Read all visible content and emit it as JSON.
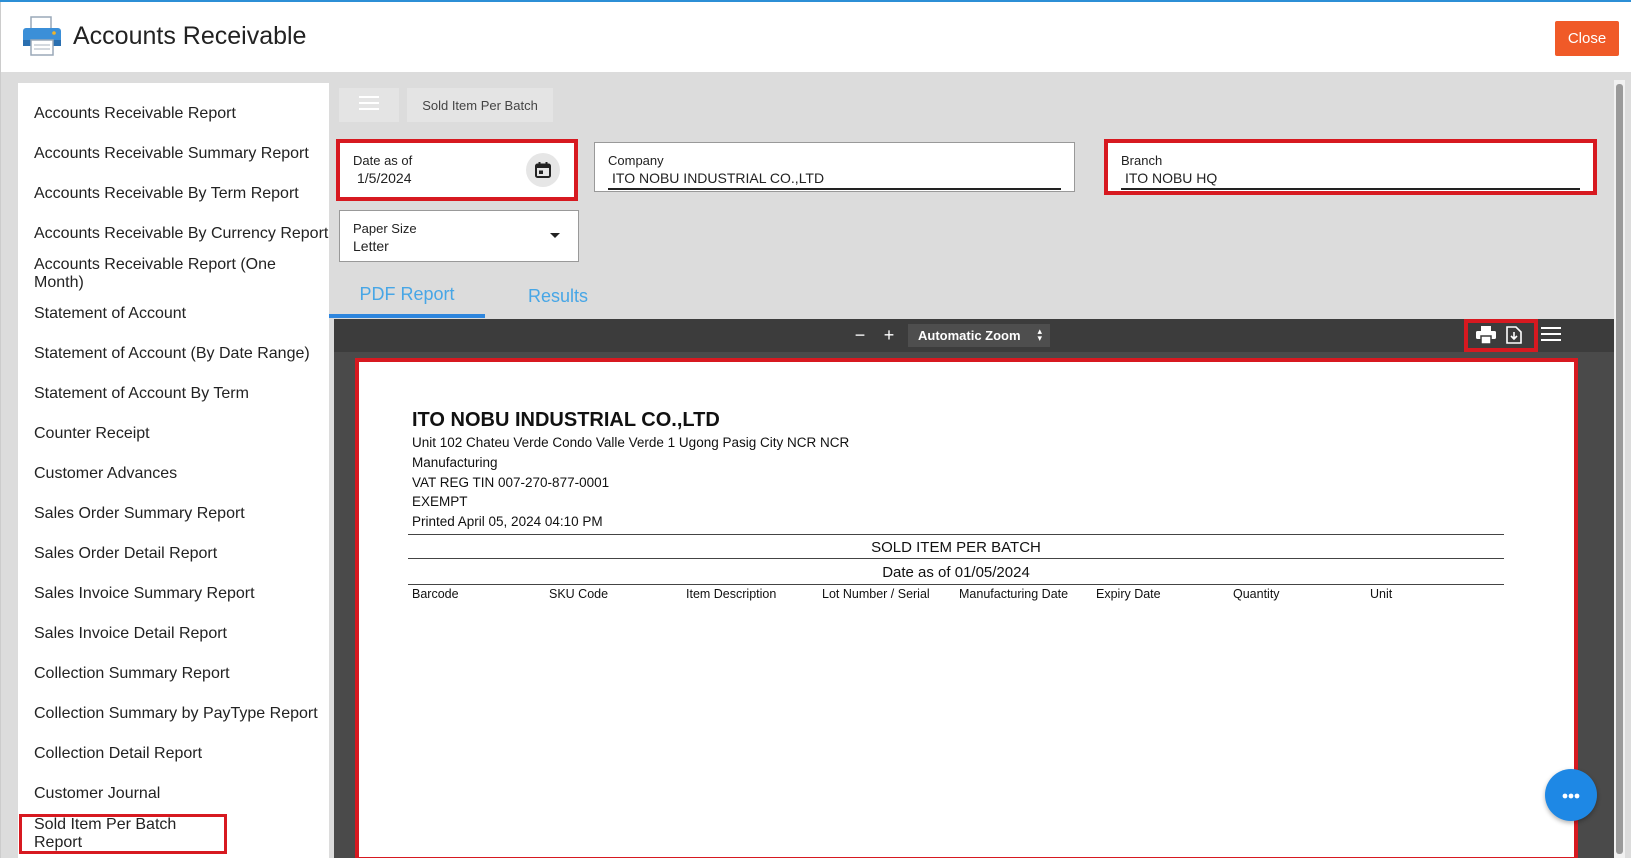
{
  "header": {
    "title": "Accounts Receivable",
    "close_label": "Close",
    "icon": "printer-icon"
  },
  "sidebar": {
    "items": [
      {
        "label": "Accounts Receivable Report"
      },
      {
        "label": "Accounts Receivable Summary Report"
      },
      {
        "label": "Accounts Receivable By Term Report"
      },
      {
        "label": "Accounts Receivable By Currency Report"
      },
      {
        "label": "Accounts Receivable Report (One Month)"
      },
      {
        "label": "Statement of Account"
      },
      {
        "label": "Statement of Account (By Date Range)"
      },
      {
        "label": "Statement of Account By Term"
      },
      {
        "label": "Counter Receipt"
      },
      {
        "label": "Customer Advances"
      },
      {
        "label": "Sales Order Summary Report"
      },
      {
        "label": "Sales Order Detail Report"
      },
      {
        "label": "Sales Invoice Summary Report"
      },
      {
        "label": "Sales Invoice Detail Report"
      },
      {
        "label": "Collection Summary Report"
      },
      {
        "label": "Collection Summary by PayType Report"
      },
      {
        "label": "Collection Detail Report"
      },
      {
        "label": "Customer Journal"
      },
      {
        "label": "Sold Item Per Batch Report",
        "highlighted": true
      }
    ]
  },
  "toolbar": {
    "tab_label": "Sold Item Per Batch"
  },
  "filters": {
    "date": {
      "label": "Date as of",
      "value": "1/5/2024"
    },
    "company": {
      "label": "Company",
      "value": "ITO NOBU INDUSTRIAL CO.,LTD"
    },
    "branch": {
      "label": "Branch",
      "value": "ITO NOBU HQ"
    },
    "paper_size": {
      "label": "Paper Size",
      "value": "Letter"
    }
  },
  "tabs": [
    {
      "label": "PDF Report",
      "active": true
    },
    {
      "label": "Results",
      "active": false
    }
  ],
  "viewer": {
    "zoom_out": "−",
    "zoom_in": "+",
    "zoom_label": "Automatic Zoom"
  },
  "report": {
    "company_name": "ITO NOBU INDUSTRIAL CO.,LTD",
    "address": "Unit 102 Chateu Verde Condo Valle Verde 1 Ugong  Pasig City NCR NCR",
    "business_type": "Manufacturing",
    "tin": "VAT REG TIN 007-270-877-0001",
    "tax_status": "EXEMPT",
    "printed": "Printed April 05, 2024 04:10 PM",
    "title": "SOLD ITEM PER BATCH",
    "date_line": "Date as of 01/05/2024",
    "columns": [
      "Barcode",
      "SKU Code",
      "Item Description",
      "Lot Number / Serial",
      "Manufacturing Date",
      "Expiry Date",
      "Quantity",
      "Unit"
    ]
  },
  "colors": {
    "accent": "#2e86de",
    "close": "#f05a28",
    "highlight": "#d71920"
  }
}
